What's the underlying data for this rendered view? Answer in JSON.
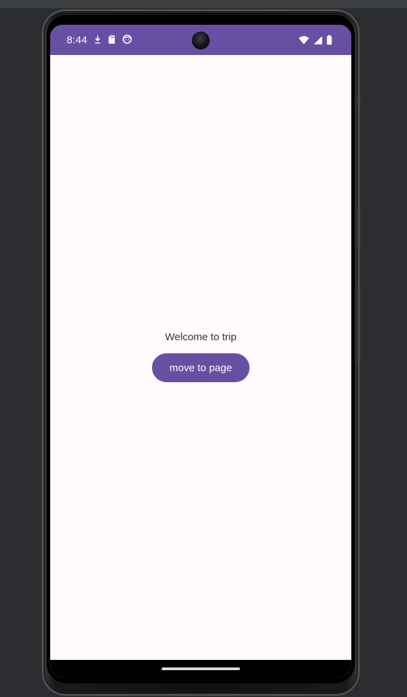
{
  "status_bar": {
    "time": "8:44",
    "left_icons": [
      "download-icon",
      "sd-card-icon",
      "face-icon"
    ],
    "right_icons": [
      "wifi-icon",
      "cellular-signal-icon",
      "battery-icon"
    ],
    "color": "#6750a4"
  },
  "main": {
    "welcome_text": "Welcome to trip",
    "button_label": "move to page"
  },
  "colors": {
    "accent": "#6750a4",
    "background": "#fffbfe",
    "ide_background": "#2b2d30"
  }
}
